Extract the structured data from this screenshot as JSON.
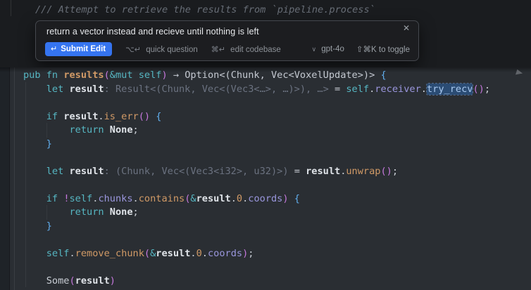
{
  "editor": {
    "comment_line": "/// Attempt to retrieve the results from `pipeline.process`",
    "inline_edit_popup": {
      "prompt": "return a vector instead and recieve until nothing is left",
      "close_icon": "✕",
      "submit_button": {
        "icon": "↵",
        "label": "Submit Edit"
      },
      "quick_question": {
        "icon": "⌥↵",
        "label": "quick question"
      },
      "edit_codebase": {
        "icon": "⌘↵",
        "label": "edit codebase"
      },
      "model_selector": {
        "chevron": "∨",
        "label": "gpt-4o"
      },
      "toggle_hint": "⇧⌘K to toggle"
    },
    "palette": {
      "accent_blue": "#3574f0",
      "occurrence_highlight_bg": "#2b4c74",
      "keyword_teal": "#56b6c2",
      "function_orange": "#d19a66",
      "field_periwinkle": "#9a96dd",
      "punctuation_purple": "#c678dd",
      "brace_blue": "#61afef",
      "inlay_hint_gray": "#6b7280",
      "comment_gray": "#686e77",
      "code_background": "#2a2e33",
      "overlay_background": "#1a1c1f"
    },
    "code_lines": [
      [
        {
          "t": "pub ",
          "c": "kw"
        },
        {
          "t": "fn ",
          "c": "kw"
        },
        {
          "t": "results",
          "c": "fn"
        },
        {
          "t": "(",
          "c": "pn"
        },
        {
          "t": "&mut self",
          "c": "kw"
        },
        {
          "t": ")",
          "c": "pn"
        },
        {
          "t": " ",
          "c": "pl"
        },
        {
          "t": "→",
          "c": "ty"
        },
        {
          "t": " ",
          "c": "pl"
        },
        {
          "t": "Option<(Chunk, Vec<VoxelUpdate>)> ",
          "c": "ty"
        },
        {
          "t": "{",
          "c": "br"
        }
      ],
      [
        {
          "t": "    ",
          "c": "pl"
        },
        {
          "t": "let ",
          "c": "kw"
        },
        {
          "t": "result",
          "c": "var"
        },
        {
          "t": ": Result<(Chunk, Vec<(Vec3<…>, …)>), …>",
          "c": "in"
        },
        {
          "t": " = ",
          "c": "pl"
        },
        {
          "t": "self",
          "c": "kw"
        },
        {
          "t": ".",
          "c": "pl"
        },
        {
          "t": "receiver",
          "c": "fd"
        },
        {
          "t": ".",
          "c": "pl"
        },
        {
          "t": "try_recv",
          "c": "hl"
        },
        {
          "t": "()",
          "c": "pn"
        },
        {
          "t": ";",
          "c": "pl"
        }
      ],
      [],
      [
        {
          "t": "    ",
          "c": "pl"
        },
        {
          "t": "if ",
          "c": "kw"
        },
        {
          "t": "result",
          "c": "var"
        },
        {
          "t": ".",
          "c": "pl"
        },
        {
          "t": "is_err",
          "c": "mt"
        },
        {
          "t": "()",
          "c": "pn"
        },
        {
          "t": " ",
          "c": "pl"
        },
        {
          "t": "{",
          "c": "br"
        }
      ],
      [
        {
          "t": "        ",
          "c": "pl"
        },
        {
          "t": "return ",
          "c": "kw"
        },
        {
          "t": "None",
          "c": "var"
        },
        {
          "t": ";",
          "c": "pl"
        }
      ],
      [
        {
          "t": "    ",
          "c": "pl"
        },
        {
          "t": "}",
          "c": "br"
        }
      ],
      [],
      [
        {
          "t": "    ",
          "c": "pl"
        },
        {
          "t": "let ",
          "c": "kw"
        },
        {
          "t": "result",
          "c": "var"
        },
        {
          "t": ": (Chunk, Vec<(Vec3<i32>, u32)>)",
          "c": "in"
        },
        {
          "t": " = ",
          "c": "pl"
        },
        {
          "t": "result",
          "c": "var"
        },
        {
          "t": ".",
          "c": "pl"
        },
        {
          "t": "unwrap",
          "c": "mt"
        },
        {
          "t": "()",
          "c": "pn"
        },
        {
          "t": ";",
          "c": "pl"
        }
      ],
      [],
      [
        {
          "t": "    ",
          "c": "pl"
        },
        {
          "t": "if ",
          "c": "kw"
        },
        {
          "t": "!",
          "c": "pn"
        },
        {
          "t": "self",
          "c": "kw"
        },
        {
          "t": ".",
          "c": "pl"
        },
        {
          "t": "chunks",
          "c": "fd"
        },
        {
          "t": ".",
          "c": "pl"
        },
        {
          "t": "contains",
          "c": "mt"
        },
        {
          "t": "(",
          "c": "pn"
        },
        {
          "t": "&",
          "c": "kw"
        },
        {
          "t": "result",
          "c": "var"
        },
        {
          "t": ".",
          "c": "pl"
        },
        {
          "t": "0",
          "c": "num"
        },
        {
          "t": ".",
          "c": "pl"
        },
        {
          "t": "coords",
          "c": "fd"
        },
        {
          "t": ")",
          "c": "pn"
        },
        {
          "t": " ",
          "c": "pl"
        },
        {
          "t": "{",
          "c": "br"
        }
      ],
      [
        {
          "t": "        ",
          "c": "pl"
        },
        {
          "t": "return ",
          "c": "kw"
        },
        {
          "t": "None",
          "c": "var"
        },
        {
          "t": ";",
          "c": "pl"
        }
      ],
      [
        {
          "t": "    ",
          "c": "pl"
        },
        {
          "t": "}",
          "c": "br"
        }
      ],
      [],
      [
        {
          "t": "    ",
          "c": "pl"
        },
        {
          "t": "self",
          "c": "kw"
        },
        {
          "t": ".",
          "c": "pl"
        },
        {
          "t": "remove_chunk",
          "c": "mt"
        },
        {
          "t": "(",
          "c": "pn"
        },
        {
          "t": "&",
          "c": "kw"
        },
        {
          "t": "result",
          "c": "var"
        },
        {
          "t": ".",
          "c": "pl"
        },
        {
          "t": "0",
          "c": "num"
        },
        {
          "t": ".",
          "c": "pl"
        },
        {
          "t": "coords",
          "c": "fd"
        },
        {
          "t": ")",
          "c": "pn"
        },
        {
          "t": ";",
          "c": "pl"
        }
      ],
      [],
      [
        {
          "t": "    ",
          "c": "pl"
        },
        {
          "t": "Some",
          "c": "pl"
        },
        {
          "t": "(",
          "c": "pn"
        },
        {
          "t": "result",
          "c": "var"
        },
        {
          "t": ")",
          "c": "pn"
        }
      ]
    ]
  }
}
